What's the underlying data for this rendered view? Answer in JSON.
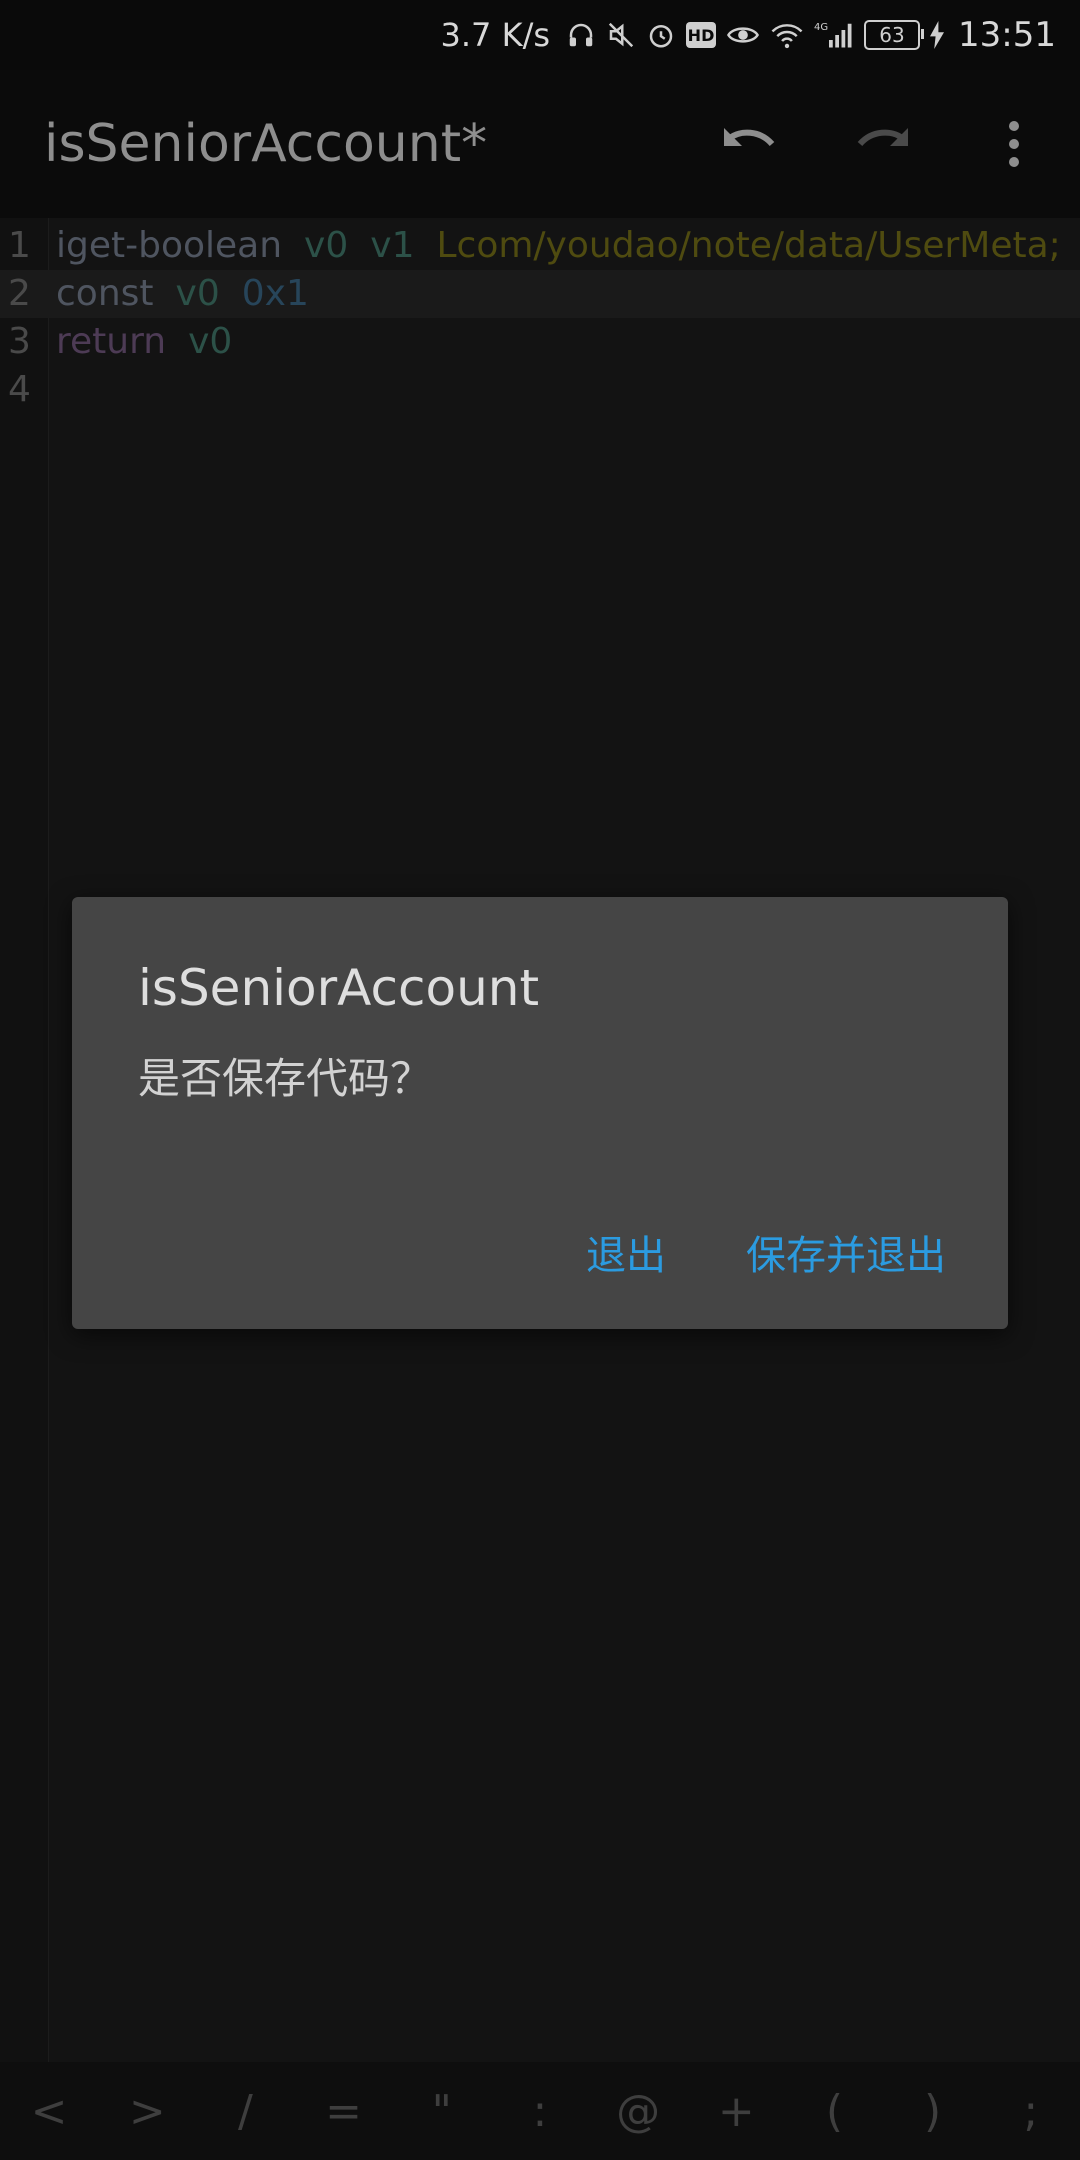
{
  "status_bar": {
    "network_speed": "3.7 K/s",
    "hd_label": "HD",
    "signal_label": "4G",
    "battery": "63",
    "time": "13:51"
  },
  "app_bar": {
    "title": "isSeniorAccount*",
    "icons": [
      "undo-icon",
      "redo-icon",
      "more-vert-icon"
    ]
  },
  "editor": {
    "lines": [
      {
        "number": "1",
        "tokens": [
          "iget-boolean",
          "v0",
          "v1",
          "Lcom/youdao/note/data/UserMeta;"
        ]
      },
      {
        "number": "2",
        "tokens": [
          "const",
          "v0",
          "0x1"
        ]
      },
      {
        "number": "3",
        "tokens": [
          "return",
          "v0"
        ]
      },
      {
        "number": "4",
        "tokens": []
      }
    ],
    "colors": {
      "instruction": "#4f5560",
      "register": "#2c5148",
      "class": "#4f4b10",
      "literal": "#27455a",
      "return": "#4d3b55"
    }
  },
  "dialog": {
    "title": "isSeniorAccount",
    "message": "是否保存代码？",
    "exit_label": "退出",
    "save_exit_label": "保存并退出",
    "accent": "#2b9be0"
  },
  "symbol_bar": {
    "symbols": [
      "<",
      ">",
      "/",
      "=",
      "\"",
      ":",
      "@",
      "+",
      "(",
      ")",
      ";"
    ]
  }
}
